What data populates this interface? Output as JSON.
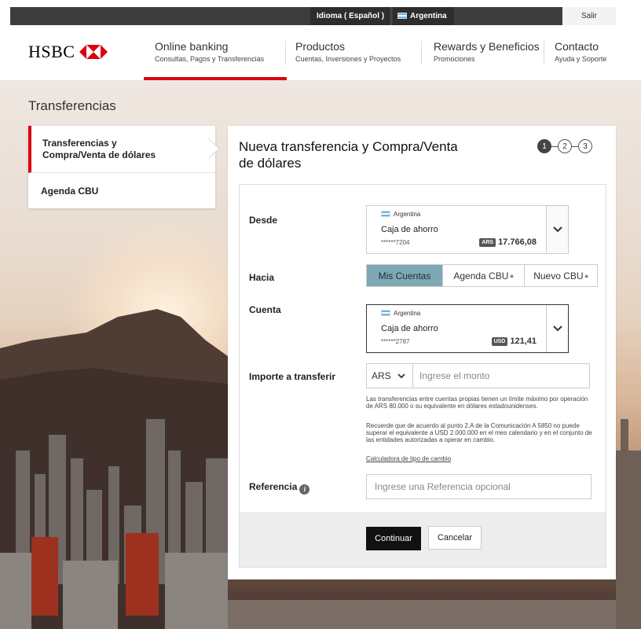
{
  "topbar": {
    "language_label": "Idioma ( Español )",
    "country_label": "Argentina",
    "logout_label": "Salir"
  },
  "header": {
    "brand": "HSBC",
    "nav": [
      {
        "label": "Online banking",
        "sub": "Consultas, Pagos y Transferencias",
        "active": true
      },
      {
        "label": "Productos",
        "sub": "Cuentas, Inversiones y Proyectos"
      },
      {
        "label": "Rewards y Beneficios",
        "sub": "Promociones"
      },
      {
        "label": "Contacto",
        "sub": "Ayuda y Soporte"
      }
    ]
  },
  "page": {
    "title": "Transferencias"
  },
  "sidebar": {
    "items": [
      {
        "label": "Transferencias y Compra/Venta de dólares",
        "active": true
      },
      {
        "label": "Agenda CBU"
      }
    ]
  },
  "panel": {
    "title": "Nueva transferencia y Compra/Venta de dólares",
    "steps": [
      "1",
      "2",
      "3"
    ],
    "current_step": 1
  },
  "form": {
    "desde": {
      "label": "Desde",
      "country": "Argentina",
      "account_type": "Caja de ahorro",
      "account_number": "******7204",
      "currency": "ARS",
      "balance": "17.766,08"
    },
    "hacia": {
      "label": "Hacia",
      "options": [
        {
          "label": "Mis Cuentas",
          "active": true
        },
        {
          "label": "Agenda CBU",
          "locked": true
        },
        {
          "label": "Nuevo CBU",
          "locked": true
        }
      ]
    },
    "cuenta": {
      "label": "Cuenta",
      "country": "Argentina",
      "account_type": "Caja de ahorro",
      "account_number": "******2787",
      "currency": "USD",
      "balance": "121,41"
    },
    "importe": {
      "label": "Importe a transferir",
      "currency": "ARS",
      "placeholder": "Ingrese el monto",
      "note1": "Las transferencias entre cuentas propias tienen un límite máximo por operación de ARS 80.000 o su equivalente en dólares estadounidenses.",
      "note2": "Recuerde que de acuerdo al punto 2.A de la Comunicación A 5850 no puede superar el equivalente a USD 2.000.000 en el mes calendario y en el conjunto de las entidades autorizadas a operar en cambio.",
      "link": "Calculadora de tipo de cambio"
    },
    "referencia": {
      "label": "Referencia",
      "placeholder": "Ingrese una Referencia opcional"
    },
    "continue_label": "Continuar",
    "cancel_label": "Cancelar"
  },
  "colors": {
    "brand_red": "#db0011",
    "segment_active": "#7fa8b5",
    "primary_button": "#111111"
  }
}
